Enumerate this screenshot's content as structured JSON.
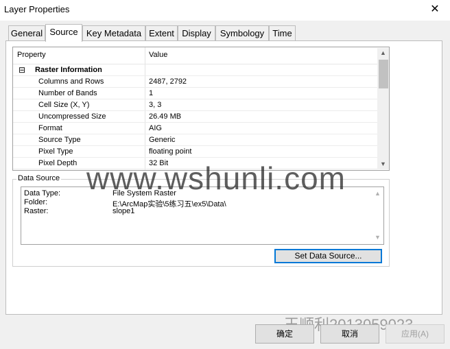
{
  "window": {
    "title": "Layer Properties",
    "close_glyph": "✕"
  },
  "tabs": [
    "General",
    "Source",
    "Key Metadata",
    "Extent",
    "Display",
    "Symbology",
    "Time"
  ],
  "property_grid": {
    "headers": {
      "property": "Property",
      "value": "Value"
    },
    "group": {
      "toggle": "⊟",
      "label": "Raster Information"
    },
    "rows": [
      {
        "label": "Columns and Rows",
        "value": "2487, 2792"
      },
      {
        "label": "Number of Bands",
        "value": "1"
      },
      {
        "label": "Cell Size (X, Y)",
        "value": "3, 3"
      },
      {
        "label": "Uncompressed Size",
        "value": "26.49 MB"
      },
      {
        "label": "Format",
        "value": "AIG"
      },
      {
        "label": "Source Type",
        "value": "Generic"
      },
      {
        "label": "Pixel Type",
        "value": "floating point"
      },
      {
        "label": "Pixel Depth",
        "value": "32 Bit"
      }
    ]
  },
  "data_source": {
    "legend": "Data Source",
    "lines": [
      {
        "label": "Data Type:",
        "value": "File System Raster"
      },
      {
        "label": "Folder:",
        "value": "E:\\ArcMap实验\\5练习五\\ex5\\Data\\"
      },
      {
        "label": "Raster:",
        "value": "slope1"
      }
    ],
    "set_button": "Set Data Source..."
  },
  "footer": {
    "ok": "确定",
    "cancel": "取消",
    "apply": "应用(A)"
  },
  "watermarks": {
    "main": "www.wshunli.com",
    "signature": "王顺利2013059023"
  },
  "colors": {
    "focus_border": "#0078d7",
    "disabled_text": "#a0a0a0"
  }
}
